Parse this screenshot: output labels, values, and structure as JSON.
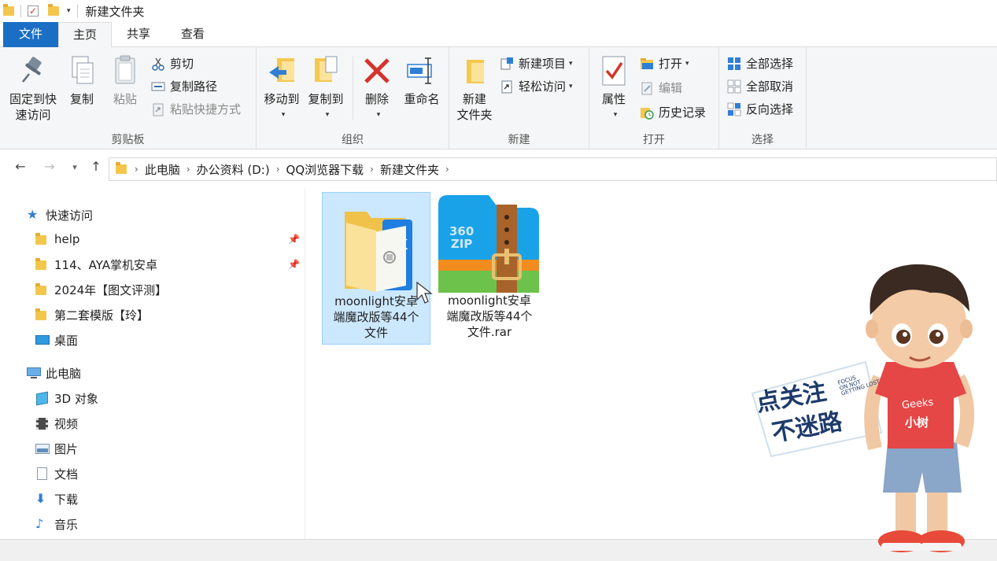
{
  "window": {
    "title": "新建文件夹"
  },
  "tabs": [
    {
      "label": "文件"
    },
    {
      "label": "主页"
    },
    {
      "label": "共享"
    },
    {
      "label": "查看"
    }
  ],
  "ribbon": {
    "clipboard": {
      "label": "剪贴板",
      "pin_quick_access": {
        "line1": "固定到快",
        "line2": "速访问"
      },
      "copy": "复制",
      "paste": "粘贴",
      "cut": "剪切",
      "copy_path": "复制路径",
      "paste_shortcut": "粘贴快捷方式"
    },
    "organize": {
      "label": "组织",
      "move_to": "移动到",
      "copy_to": "复制到",
      "delete": "删除",
      "rename": "重命名"
    },
    "new": {
      "label": "新建",
      "new_folder": {
        "line1": "新建",
        "line2": "文件夹"
      },
      "new_item": "新建项目",
      "easy_access": "轻松访问"
    },
    "open": {
      "label": "打开",
      "properties": "属性",
      "open": "打开",
      "edit": "编辑",
      "history": "历史记录"
    },
    "select": {
      "label": "选择",
      "select_all": "全部选择",
      "select_none": "全部取消",
      "invert": "反向选择"
    }
  },
  "address": {
    "crumbs": [
      "此电脑",
      "办公资料 (D:)",
      "QQ浏览器下载",
      "新建文件夹"
    ]
  },
  "navpane": {
    "quick_access": "快速访问",
    "quick_items": [
      {
        "label": "help",
        "pinned": true
      },
      {
        "label": "114、AYA掌机安卓",
        "pinned": true
      },
      {
        "label": "2024年【图文评测】",
        "pinned": false
      },
      {
        "label": "第二套模版【玲】",
        "pinned": false
      },
      {
        "label": "桌面",
        "pinned": false
      }
    ],
    "this_pc": "此电脑",
    "pc_items": [
      {
        "label": "3D 对象"
      },
      {
        "label": "视频"
      },
      {
        "label": "图片"
      },
      {
        "label": "文档"
      },
      {
        "label": "下载"
      },
      {
        "label": "音乐"
      }
    ]
  },
  "files": [
    {
      "line1": "moonlight安卓",
      "line2": "端魔改版等44个",
      "line3": "文件",
      "type": "folder",
      "selected": true
    },
    {
      "line1": "moonlight安卓",
      "line2": "端魔改版等44个",
      "line3": "文件.rar",
      "type": "rar",
      "selected": false,
      "badge_top": "360",
      "badge_bottom": "ZIP"
    }
  ],
  "overlay": {
    "sticker_line1": "点关注",
    "sticker_line2": "不迷路",
    "sticker_en1": "FOCUS",
    "sticker_en2": "ON NOT",
    "sticker_en3": "GETTING LOST",
    "shirt_text1": "Geeks",
    "shirt_text2": "小树"
  },
  "colors": {
    "accent": "#1a6fc5",
    "folder": "#f3c74c",
    "selection": "#cce8ff",
    "delete_red": "#d4342a"
  }
}
